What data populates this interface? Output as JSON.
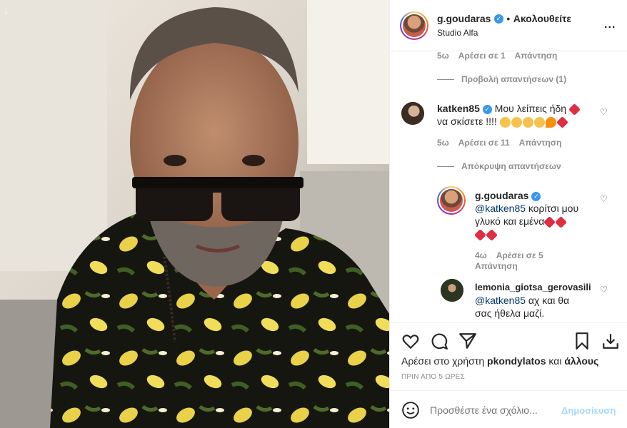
{
  "header": {
    "username": "g.goudaras",
    "dot": "•",
    "follow_status": "Ακολουθείτε",
    "location": "Studio Alfa",
    "more": "..."
  },
  "comments": {
    "top_meta": {
      "age": "5ω",
      "likes": "Αρέσει σε 1",
      "reply": "Απάντηση"
    },
    "view_replies": "Προβολή απαντήσεων (1)",
    "c1": {
      "username": "katken85",
      "line1": "Μου λείπεις ήδη",
      "line2": "να σκίσετε !!!!",
      "meta": {
        "age": "5ω",
        "likes": "Αρέσει σε 11",
        "reply": "Απάντηση"
      }
    },
    "hide_replies": "Απόκρυψη απαντήσεων",
    "r1": {
      "username": "g.goudaras",
      "mention": "@katken85",
      "text1": " κορίτσι μου",
      "text2": "γλυκό και εμένα",
      "meta": {
        "age": "4ω",
        "likes": "Αρέσει σε 5",
        "reply": "Απάντηση"
      }
    },
    "r2": {
      "username": "lemonia_giotsa_gerovasili",
      "mention": "@katken85",
      "text1": " αχ και θα",
      "text2": "σας ήθελα μαζί."
    }
  },
  "actions": {
    "likes_prefix": "Αρέσει στο χρήστη",
    "likes_user": "pkondylatos",
    "likes_and": "και",
    "likes_others": "άλλους",
    "timestamp": "ΠΡΙΝ ΑΠΟ 5 ΩΡΕΣ"
  },
  "composer": {
    "placeholder": "Προσθέστε ένα σχόλιο...",
    "post": "Δημοσίευση"
  },
  "colors": {
    "link": "#0095f6",
    "text": "#262626",
    "meta": "#8e8e8e",
    "heart": "#dd2e44"
  }
}
